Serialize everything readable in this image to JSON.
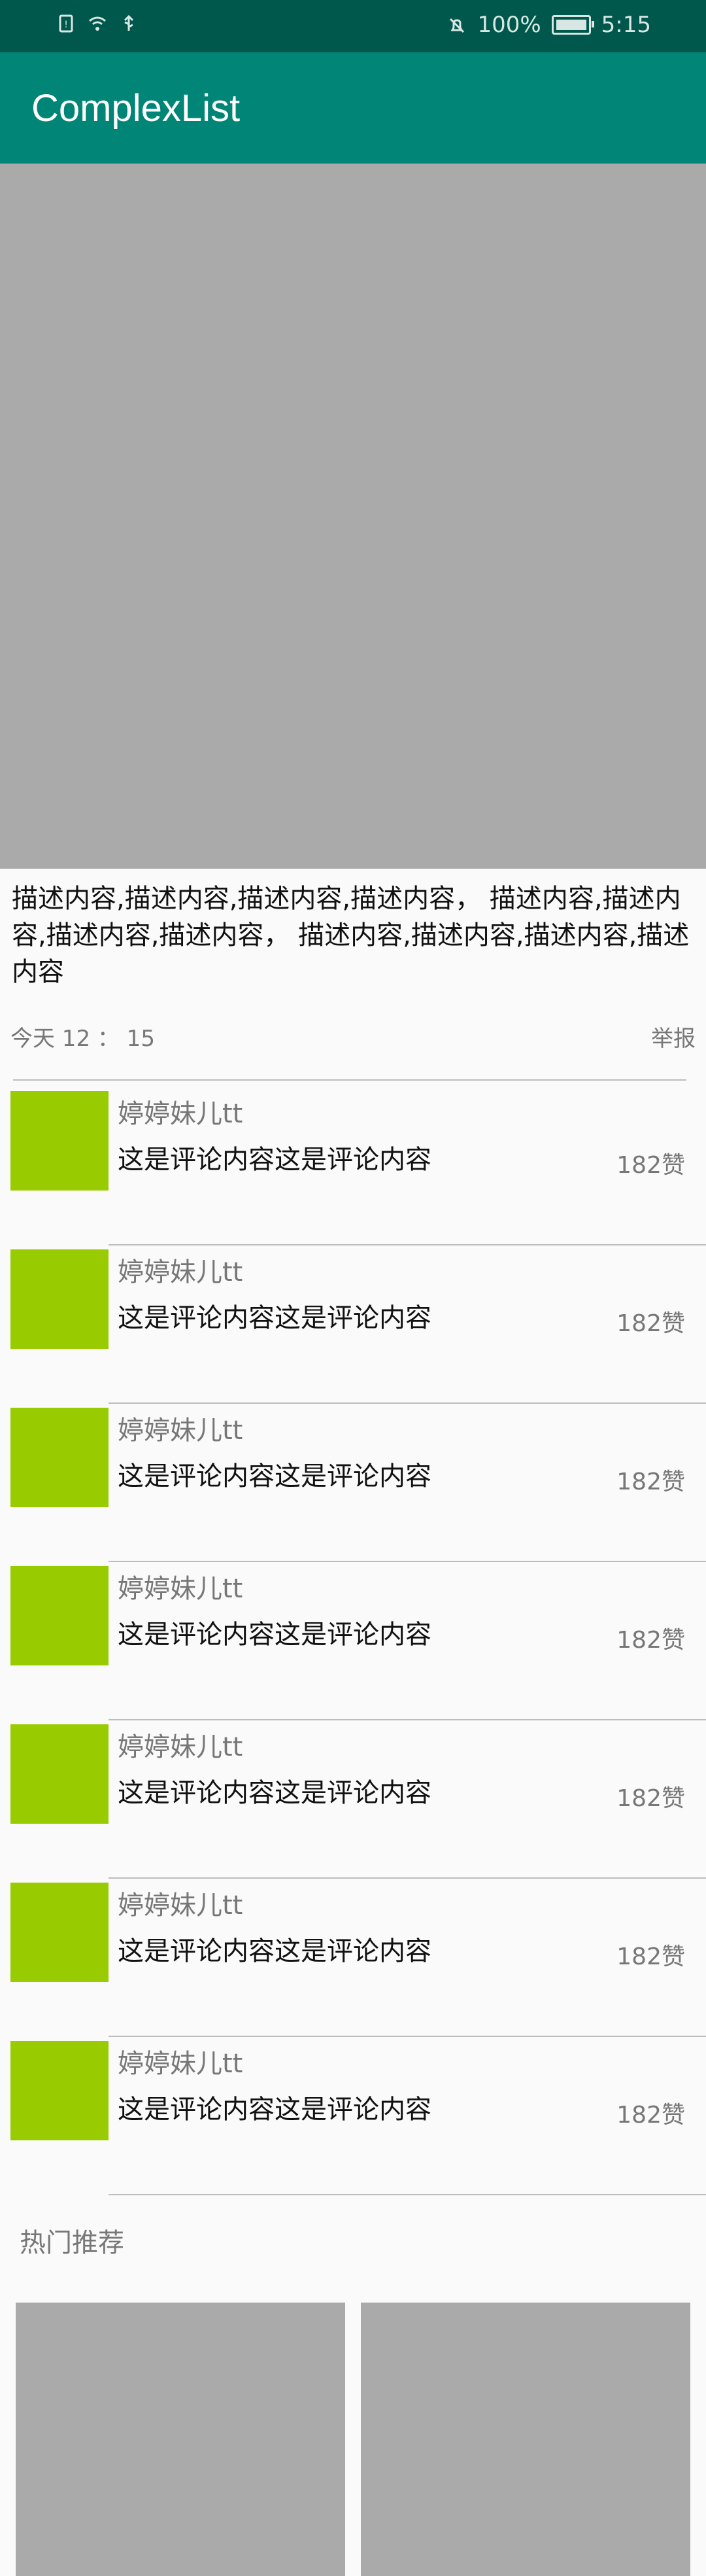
{
  "status_bar": {
    "battery_percent": "100%",
    "time": "5:15",
    "icons": [
      "sim-icon",
      "wifi-icon",
      "usb-icon",
      "mute-icon",
      "battery-icon"
    ]
  },
  "app": {
    "title": "ComplexList"
  },
  "post": {
    "description": "描述内容,描述内容,描述内容,描述内容， 描述内容,描述内容,描述内容,描述内容， 描述内容,描述内容,描述内容,描述内容",
    "time": "今天 12 ： 15",
    "report_label": "举报"
  },
  "comments": [
    {
      "user": "婷婷妹儿tt",
      "text": "这是评论内容这是评论内容",
      "likes": "182赞"
    },
    {
      "user": "婷婷妹儿tt",
      "text": "这是评论内容这是评论内容",
      "likes": "182赞"
    },
    {
      "user": "婷婷妹儿tt",
      "text": "这是评论内容这是评论内容",
      "likes": "182赞"
    },
    {
      "user": "婷婷妹儿tt",
      "text": "这是评论内容这是评论内容",
      "likes": "182赞"
    },
    {
      "user": "婷婷妹儿tt",
      "text": "这是评论内容这是评论内容",
      "likes": "182赞"
    },
    {
      "user": "婷婷妹儿tt",
      "text": "这是评论内容这是评论内容",
      "likes": "182赞"
    },
    {
      "user": "婷婷妹儿tt",
      "text": "这是评论内容这是评论内容",
      "likes": "182赞"
    }
  ],
  "recommendations": {
    "title": "热门推荐"
  },
  "colors": {
    "status_bar": "#00574b",
    "app_bar": "#008577",
    "avatar": "#99cc00",
    "image_placeholder": "#aaaaaa"
  }
}
